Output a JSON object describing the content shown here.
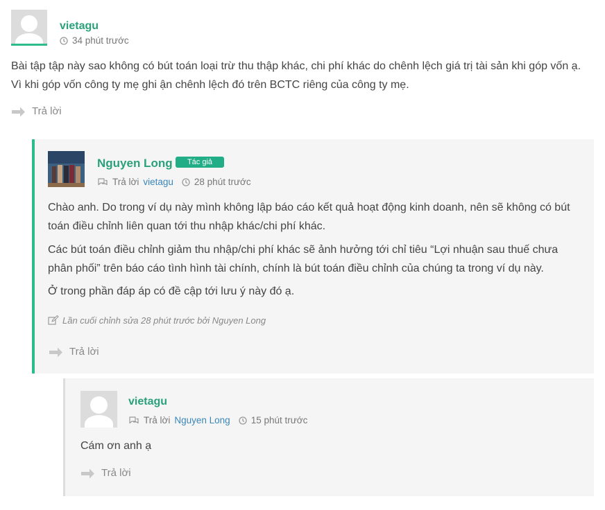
{
  "comment1": {
    "author": "vietagu",
    "time": "34 phút trước",
    "text": "Bài tập tập này sao không có bút toán loại trừ thu thập khác, chi phí khác do chênh lệch giá trị tài sản khi góp vốn ạ. Vì khi góp vốn công ty mẹ ghi ận chênh lệch đó trên BCTC riêng của công ty mẹ.",
    "reply_label": "Trả lời"
  },
  "comment2": {
    "author": "Nguyen Long",
    "badge": "Tác giả",
    "reply_to_label": "Trả lời",
    "reply_to_user": "vietagu",
    "time": "28 phút trước",
    "paragraphs": [
      "Chào anh. Do trong ví dụ này mình không lập báo cáo kết quả hoạt động kinh doanh, nên sẽ không có bút toán điều chỉnh liên quan tới thu nhập khác/chi phí khác.",
      "Các bút toán điều chỉnh giảm thu nhập/chi phí khác sẽ ảnh hưởng tới chỉ tiêu “Lợi nhuận sau thuế chưa phân phối” trên báo cáo tình hình tài chính, chính là bút toán điều chỉnh của chúng ta trong ví dụ này.",
      "Ở trong phần đáp áp có đề cập tới lưu ý này đó ạ."
    ],
    "edited_note": "Lần cuối chỉnh sửa 28 phút trước bởi Nguyen Long",
    "reply_label": "Trả lời",
    "accent_color": "#2dba8c"
  },
  "comment3": {
    "author": "vietagu",
    "reply_to_label": "Trả lời",
    "reply_to_user": "Nguyen Long",
    "time": "15 phút trước",
    "text": "Cám ơn anh ạ",
    "reply_label": "Trả lời",
    "accent_color": "#dddddd"
  }
}
